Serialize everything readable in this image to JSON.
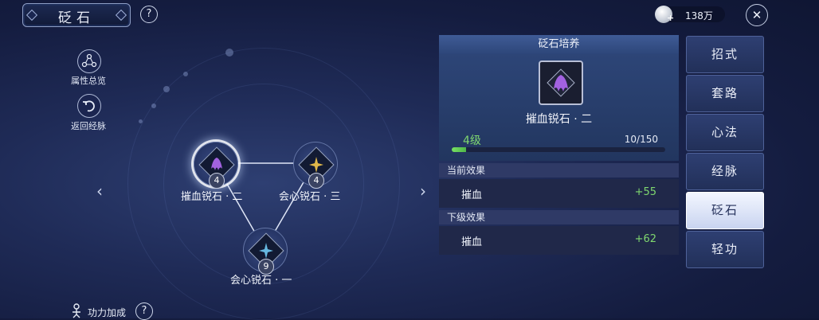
{
  "header": {
    "title": "砭石",
    "help_glyph": "?"
  },
  "left_menu": [
    {
      "label": "属性总览",
      "icon": "attribute-overview-icon"
    },
    {
      "label": "返回经脉",
      "icon": "return-arrow-icon"
    }
  ],
  "currency": {
    "amount": "138万",
    "plus": "+"
  },
  "close_glyph": "✕",
  "nav": {
    "prev": "‹",
    "next": "›"
  },
  "nodes": [
    {
      "label": "摧血锐石 · 二",
      "level": "4",
      "selected": true
    },
    {
      "label": "会心锐石 · 三",
      "level": "4",
      "selected": false
    },
    {
      "label": "会心锐石 · 一",
      "level": "9",
      "selected": false
    }
  ],
  "panel": {
    "title": "砭石培养",
    "item_name": "摧血锐石 · 二",
    "level": "4级",
    "exp": "10/150",
    "progress": 0.067,
    "current_label": "当前效果",
    "current_stat": {
      "name": "摧血",
      "value": "+55"
    },
    "next_label": "下级效果",
    "next_stat": {
      "name": "摧血",
      "value": "+62"
    }
  },
  "tabs": [
    "招式",
    "套路",
    "心法",
    "经脉",
    "砭石",
    "轻功"
  ],
  "active_tab": "砭石",
  "bottom": {
    "label": "功力加成",
    "help_glyph": "?"
  },
  "colors": {
    "accent_green": "#7fd86f",
    "panel_blue": "#2d4577",
    "bg": "#1f2b57"
  }
}
